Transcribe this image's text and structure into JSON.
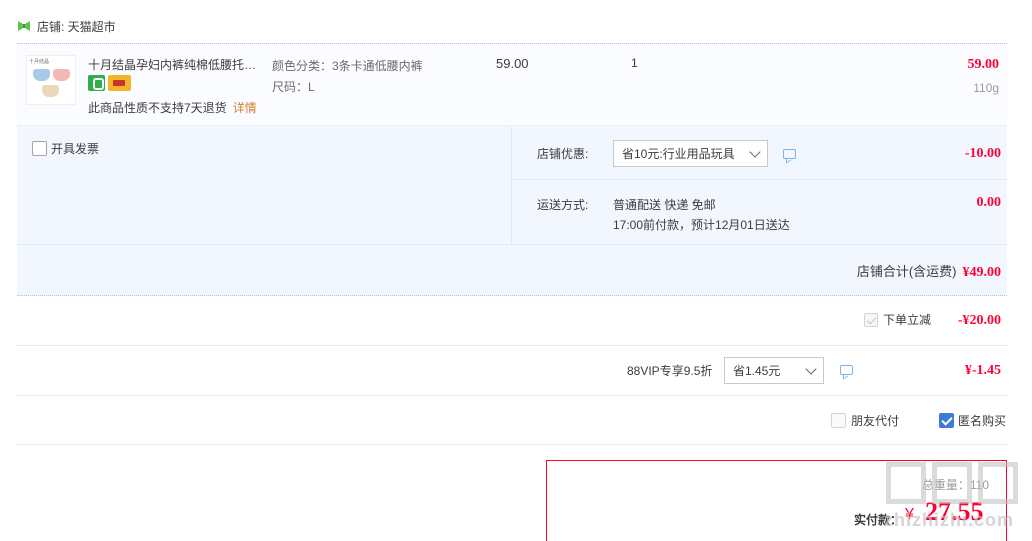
{
  "shop": {
    "label": "店铺: 天猫超市"
  },
  "item": {
    "thumb_caption": "十月结晶",
    "title": "十月结晶孕妇内裤纯棉低腰托腹女孕期中晚期早期初期怀孕透气短裤",
    "attr_color": "颜色分类：3条卡通低腰内裤",
    "attr_size": "尺码：L",
    "unit_price": "59.00",
    "quantity": "1",
    "subtotal": "59.00",
    "weight": "110g",
    "return_note": "此商品性质不支持7天退货",
    "return_link": "详情"
  },
  "invoice": {
    "label": "开具发票"
  },
  "discount": {
    "label": "店铺优惠:",
    "selected": "省10元:行业用品玩具",
    "amount": "-10.00"
  },
  "shipping": {
    "label": "运送方式:",
    "line1": "普通配送 快递 免邮",
    "line2": "17:00前付款，预计12月01日送达",
    "amount": "0.00"
  },
  "shop_total": {
    "label": "店铺合计(含运费)",
    "amount": "¥49.00"
  },
  "instant_cut": {
    "label": "下单立减",
    "amount": "-¥20.00"
  },
  "vip": {
    "label": "88VIP专享9.5折",
    "selected": "省1.45元",
    "amount": "¥-1.45"
  },
  "options": {
    "friend_pay": "朋友代付",
    "anon_buy": "匿名购买"
  },
  "summary": {
    "weight_text": "总重量：110",
    "pay_label": "实付款：",
    "currency": "¥",
    "pay_amount": "27.55"
  },
  "watermark": {
    "text": "zhizhizhi.com"
  },
  "colors": {
    "accent": "#ff0036",
    "panel": "#f2f7ff",
    "checkbox": "#3f7ad8",
    "link": "#d07f2b"
  }
}
